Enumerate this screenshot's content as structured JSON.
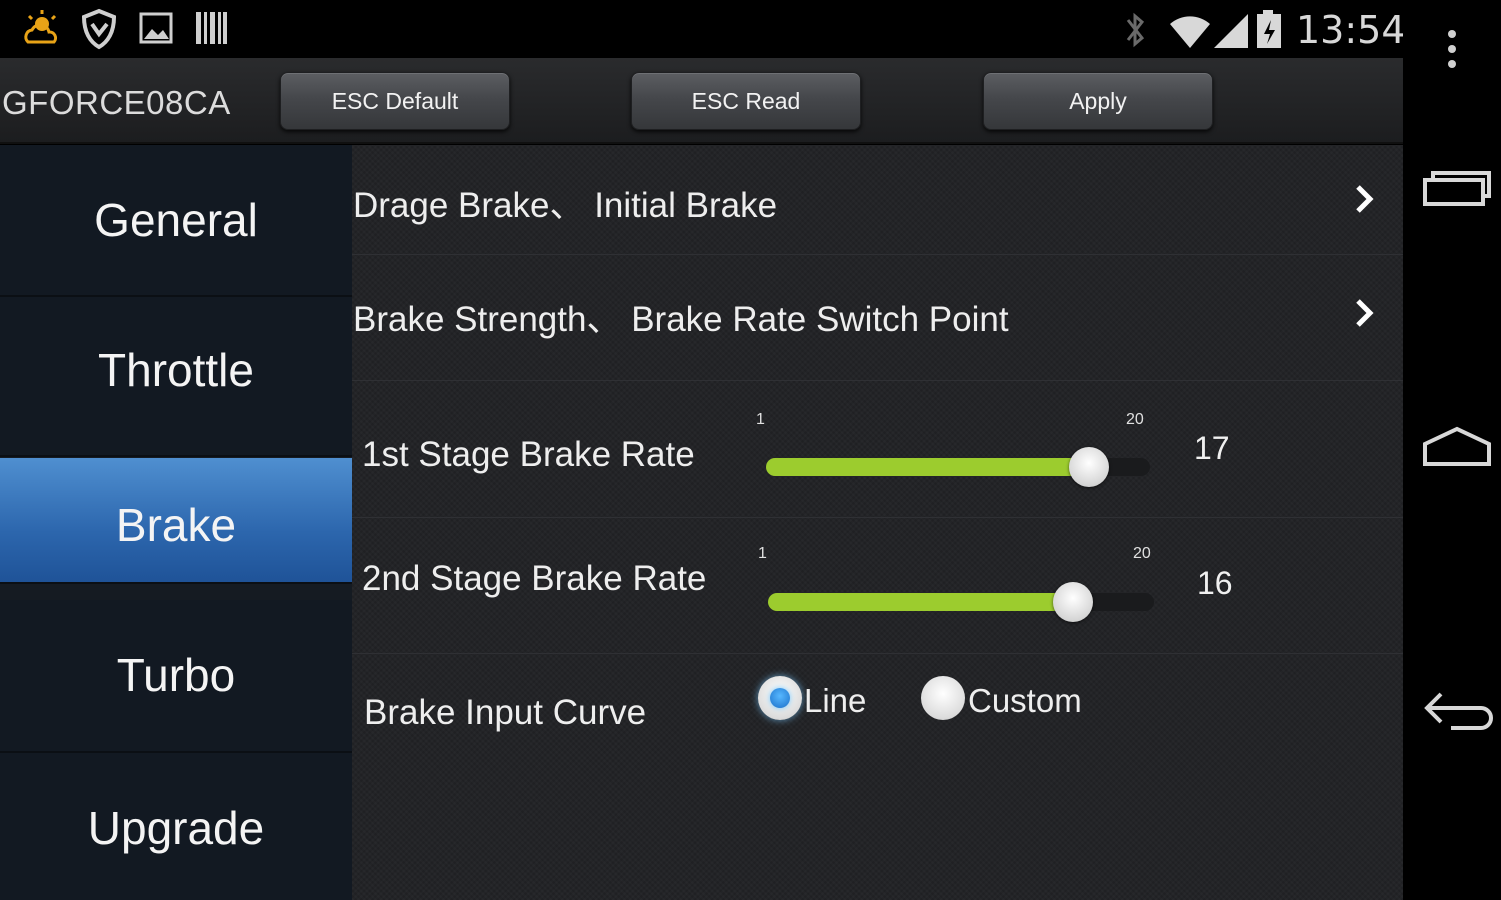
{
  "status_bar": {
    "left_icons": [
      "weather-icon",
      "shield-icon",
      "image-icon",
      "barcode-icon"
    ],
    "right_icons": [
      "bluetooth-icon",
      "wifi-icon",
      "signal-icon",
      "battery-icon"
    ],
    "time": "13:54"
  },
  "action_bar": {
    "device_name": "GFORCE08CA",
    "buttons": [
      "ESC Default",
      "ESC Read",
      "Apply"
    ]
  },
  "sidebar": {
    "items": [
      {
        "label": "General",
        "active": false
      },
      {
        "label": "Throttle",
        "active": false
      },
      {
        "label": "Brake",
        "active": true
      },
      {
        "label": "Turbo",
        "active": false
      },
      {
        "label": "Upgrade",
        "active": false
      }
    ],
    "active_color": "#2c66ad"
  },
  "content": {
    "nav_rows": [
      {
        "label": "Drage Brake、 Initial Brake"
      },
      {
        "label": "Brake Strength、 Brake Rate Switch Point"
      }
    ],
    "sliders": [
      {
        "label": "1st Stage Brake Rate",
        "min": 1,
        "max": 20,
        "value": 17
      },
      {
        "label": "2nd Stage Brake Rate",
        "min": 1,
        "max": 20,
        "value": 16
      }
    ],
    "input_curve": {
      "label": "Brake Input Curve",
      "options": [
        "Line",
        "Custom"
      ],
      "selected": "Line"
    },
    "accent_color": "#9ccc2e"
  },
  "system_nav": {
    "icons": [
      "overflow-menu-icon",
      "recent-apps-icon",
      "home-icon",
      "back-icon"
    ]
  }
}
